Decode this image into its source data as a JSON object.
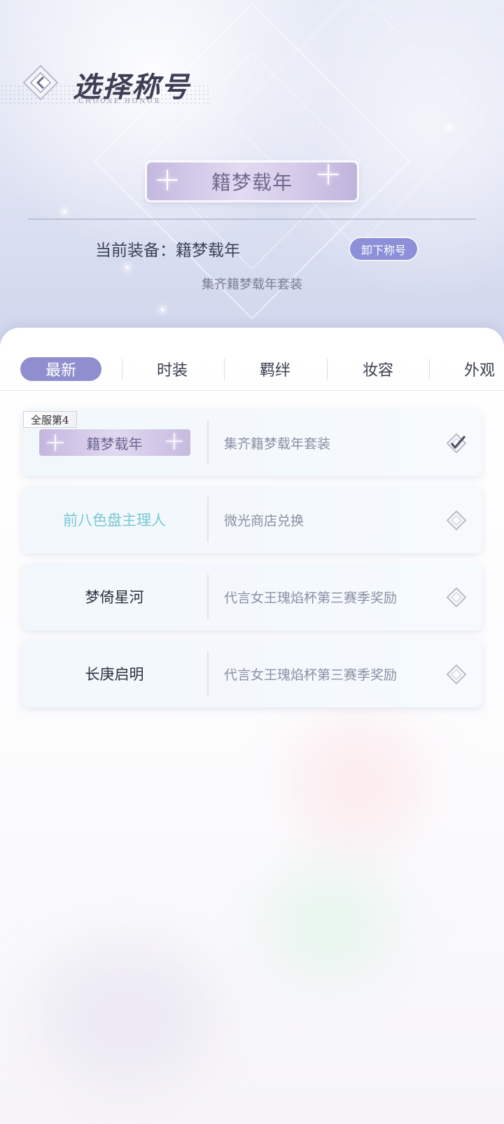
{
  "header": {
    "title": "选择称号",
    "subtitle": "CHOOSE HONOR",
    "current_plate": "籍梦载年",
    "equip_label": "当前装备：籍梦载年",
    "unequip_button": "卸下称号",
    "equip_desc": "集齐籍梦载年套装"
  },
  "tabs": [
    {
      "label": "最新",
      "active": true
    },
    {
      "label": "时装",
      "active": false
    },
    {
      "label": "羁绊",
      "active": false
    },
    {
      "label": "妆容",
      "active": false
    },
    {
      "label": "外观",
      "active": false
    }
  ],
  "titles": [
    {
      "name": "籍梦载年",
      "desc": "集齐籍梦载年套装",
      "rank_badge": "全服第4",
      "style": "plate",
      "selected": true
    },
    {
      "name": "前八色盘主理人",
      "desc": "微光商店兑换",
      "style": "teal",
      "selected": false
    },
    {
      "name": "梦倚星河",
      "desc": "代言女王瑰焰杯第三赛季奖励",
      "style": "plain",
      "selected": false
    },
    {
      "name": "长庚启明",
      "desc": "代言女王瑰焰杯第三赛季奖励",
      "style": "plain",
      "selected": false
    }
  ],
  "colors": {
    "accent": "#8f8fcf",
    "unequip_button": "#8d90d8",
    "teal_name": "#7ac8d3"
  }
}
